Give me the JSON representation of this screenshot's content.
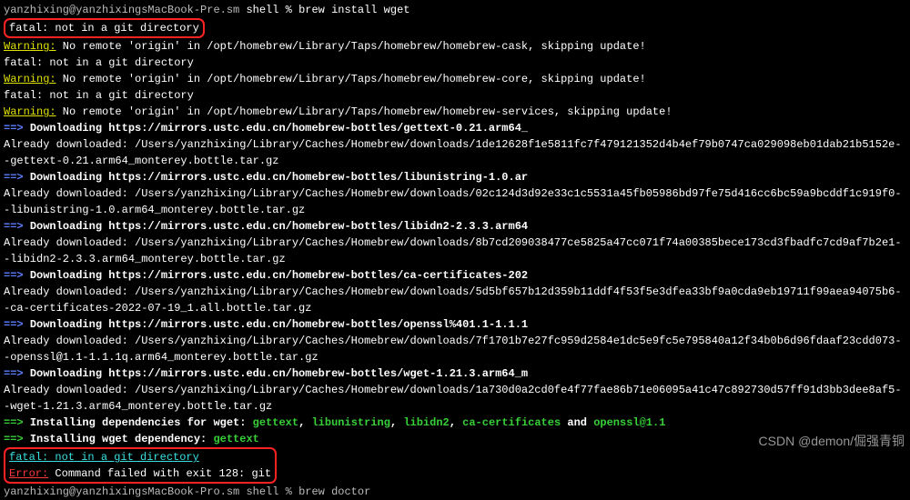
{
  "prompt": {
    "user_host": "yanzhixing@yanzhixingsMacBook-Pre.sm",
    "shell": " shell % ",
    "cmd": "brew install wget"
  },
  "fatal": "fatal: not in a git directory",
  "warn1": {
    "pre": "Warning:",
    "txt": " No remote 'origin' in /opt/homebrew/Library/Taps/homebrew/homebrew-cask, skipping update!"
  },
  "warn2": {
    "pre": "Warning:",
    "txt": " No remote 'origin' in /opt/homebrew/Library/Taps/homebrew/homebrew-core, skipping update!"
  },
  "warn3": {
    "pre": "Warning:",
    "txt": " No remote 'origin' in /opt/homebrew/Library/Taps/homebrew/homebrew-services, skipping update!"
  },
  "arrow": "==> ",
  "dl1": {
    "t": "Downloading https://mirrors.ustc.edu.cn/homebrew-bottles/gettext-0.21.arm64_",
    "a": "Already downloaded: /Users/yanzhixing/Library/Caches/Homebrew/downloads/1de12628f1e5811fc7f479121352d4b4ef79b0747ca029098eb01dab21b5152e--gettext-0.21.arm64_monterey.bottle.tar.gz"
  },
  "dl2": {
    "t": "Downloading https://mirrors.ustc.edu.cn/homebrew-bottles/libunistring-1.0.ar",
    "a": "Already downloaded: /Users/yanzhixing/Library/Caches/Homebrew/downloads/02c124d3d92e33c1c5531a45fb05986bd97fe75d416cc6bc59a9bcddf1c919f0--libunistring-1.0.arm64_monterey.bottle.tar.gz"
  },
  "dl3": {
    "t": "Downloading https://mirrors.ustc.edu.cn/homebrew-bottles/libidn2-2.3.3.arm64",
    "a": "Already downloaded: /Users/yanzhixing/Library/Caches/Homebrew/downloads/8b7cd209038477ce5825a47cc071f74a00385bece173cd3fbadfc7cd9af7b2e1--libidn2-2.3.3.arm64_monterey.bottle.tar.gz"
  },
  "dl4": {
    "t": "Downloading https://mirrors.ustc.edu.cn/homebrew-bottles/ca-certificates-202",
    "a": "Already downloaded: /Users/yanzhixing/Library/Caches/Homebrew/downloads/5d5bf657b12d359b11ddf4f53f5e3dfea33bf9a0cda9eb19711f99aea94075b6--ca-certificates-2022-07-19_1.all.bottle.tar.gz"
  },
  "dl5": {
    "t": "Downloading https://mirrors.ustc.edu.cn/homebrew-bottles/openssl%401.1-1.1.1",
    "a": "Already downloaded: /Users/yanzhixing/Library/Caches/Homebrew/downloads/7f1701b7e27fc959d2584e1dc5e9fc5e795840a12f34b0b6d96fdaaf23cdd073--openssl@1.1-1.1.1q.arm64_monterey.bottle.tar.gz"
  },
  "dl6": {
    "t": "Downloading https://mirrors.ustc.edu.cn/homebrew-bottles/wget-1.21.3.arm64_m",
    "a": "Already downloaded: /Users/yanzhixing/Library/Caches/Homebrew/downloads/1a730d0a2cd0fe4f77fae86b71e06095a41c47c892730d57ff91d3bb3dee8af5--wget-1.21.3.arm64_monterey.bottle.tar.gz"
  },
  "deps": {
    "pre": "Installing dependencies for wget: ",
    "d1": "gettext",
    "d2": "libunistring",
    "d3": "libidn2",
    "d4": "ca-certificates",
    "and": " and ",
    "d5": "openssl@1.1",
    "sep": ", "
  },
  "inst": {
    "pre": "Installing wget dependency: ",
    "pkg": "gettext"
  },
  "err": {
    "pre": "Error:",
    "txt": " Command failed with exit 128: git"
  },
  "bottom_prompt": {
    "host": "yanzhixing@yanzhixingsMacBook-Pro.sm shell % ",
    "cmd": "brew doctor"
  },
  "watermark": "CSDN @demon/倔强青铜"
}
